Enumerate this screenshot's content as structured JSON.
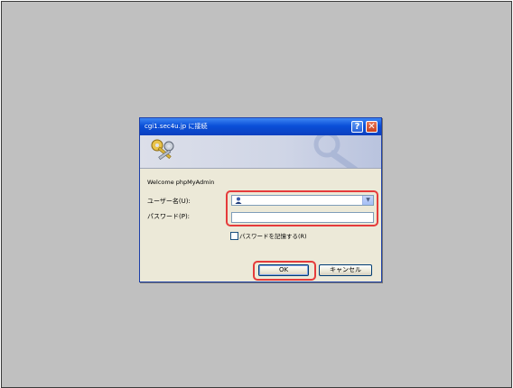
{
  "dialog": {
    "title": "cgi1.sec4u.jp に接続",
    "welcome": "Welcome phpMyAdmin",
    "help_symbol": "?",
    "close_symbol": "✕",
    "icon": "keys-icon"
  },
  "form": {
    "username_label": "ユーザー名(U):",
    "username_value": "",
    "password_label": "パスワード(P):",
    "password_value": "",
    "remember_label": "パスワードを記憶する(R)",
    "remember_checked": false
  },
  "buttons": {
    "ok_label": "OK",
    "cancel_label": "キャンセル"
  },
  "colors": {
    "titlebar": "#0a4fd8",
    "dialog_bg": "#ece9d8",
    "highlight": "#e53b3b",
    "background": "#c0c0c0"
  }
}
